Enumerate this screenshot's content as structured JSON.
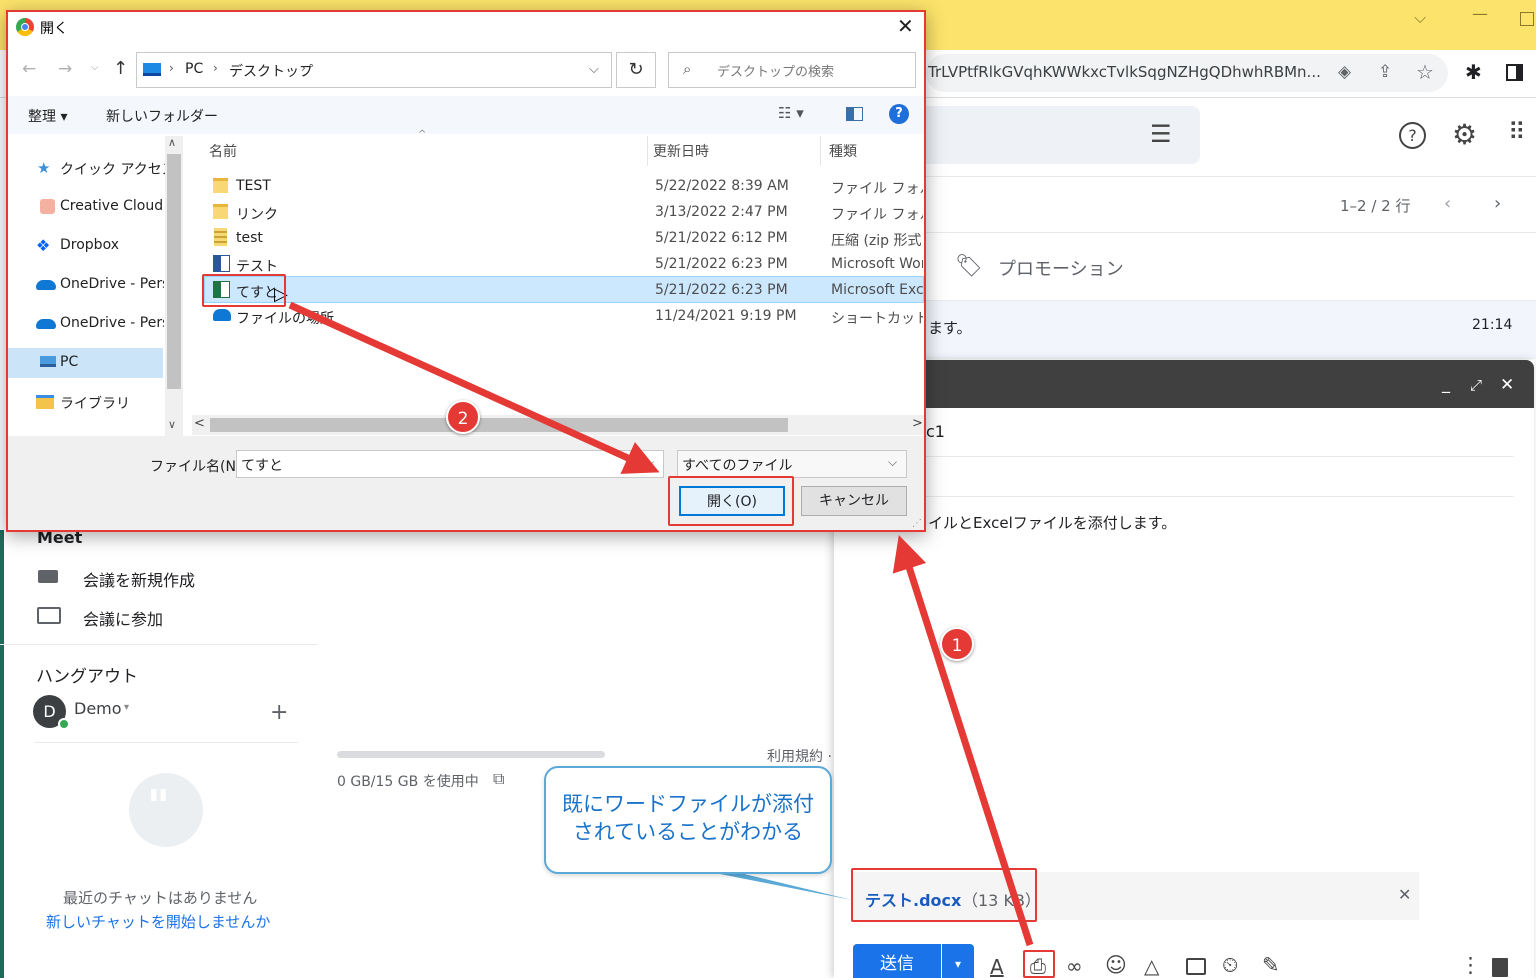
{
  "browser": {
    "url": "TrLVPtfRlkGVqhKWWkxcTvlkSqgNZHgQDhwhRBMn..."
  },
  "gmail": {
    "pagination": "1–2 / 2 行",
    "category_promotions": "プロモーション",
    "mail_snippet": "ます。",
    "mail_time": "21:14",
    "meet_title": "Meet",
    "meet_new": "会議を新規作成",
    "meet_join": "会議に参加",
    "hangout_title": "ハングアウト",
    "user_initial": "D",
    "user_name": "Demo",
    "no_chats": "最近のチャットはありません",
    "start_chat": "新しいチャットを開始しませんか",
    "storage": "0 GB/15 GB を使用中",
    "terms": "利用規約 ·"
  },
  "compose": {
    "to_fragment": "c1",
    "body_text": "イルとExcelファイルを添付します。",
    "attachment_name": "テスト.docx",
    "attachment_size": "（13 KB）",
    "send_label": "送信"
  },
  "dialog": {
    "title": "開く",
    "breadcrumb": [
      "PC",
      "デスクトップ"
    ],
    "search_placeholder": "デスクトップの検索",
    "organize": "整理 ▾",
    "new_folder": "新しいフォルダー",
    "nav_items": [
      {
        "label": "クイック アクセス",
        "icon": "star-icon"
      },
      {
        "label": "Creative Cloud F",
        "icon": "creative-cloud-icon"
      },
      {
        "label": "Dropbox",
        "icon": "dropbox-icon"
      },
      {
        "label": "OneDrive - Pers",
        "icon": "onedrive-icon"
      },
      {
        "label": "OneDrive - Pers",
        "icon": "onedrive-icon"
      },
      {
        "label": "PC",
        "icon": "pc-icon"
      },
      {
        "label": "ライブラリ",
        "icon": "library-icon"
      }
    ],
    "columns": {
      "name": "名前",
      "date": "更新日時",
      "type": "種類"
    },
    "files": [
      {
        "name": "TEST",
        "date": "5/22/2022 8:39 AM",
        "type": "ファイル フォルダー",
        "icon": "folder-icon"
      },
      {
        "name": "リンク",
        "date": "3/13/2022 2:47 PM",
        "type": "ファイル フォルダー",
        "icon": "folder-icon"
      },
      {
        "name": "test",
        "date": "5/21/2022 6:12 PM",
        "type": "圧縮 (zip 形式)",
        "icon": "zip-icon"
      },
      {
        "name": "テスト",
        "date": "5/21/2022 6:23 PM",
        "type": "Microsoft Word",
        "icon": "word-icon"
      },
      {
        "name": "てすと",
        "date": "5/21/2022 6:23 PM",
        "type": "Microsoft Excel",
        "icon": "excel-icon"
      },
      {
        "name": "ファイルの場所",
        "date": "11/24/2021 9:19 PM",
        "type": "ショートカット",
        "icon": "shortcut-icon"
      }
    ],
    "filename_label": "ファイル名(N):",
    "filename_value": "てすと",
    "filetype_value": "すべてのファイル",
    "open_label": "開く(O)",
    "cancel_label": "キャンセル"
  },
  "annotations": {
    "badge1": "1",
    "badge2": "2",
    "callout_line1": "既にワードファイルが添付",
    "callout_line2": "されていることがわかる"
  },
  "colors": {
    "annotation_red": "#e53935",
    "callout_blue": "#5aa9d6",
    "gmail_blue": "#1a73e8",
    "chrome_yellow": "#fce36b"
  }
}
